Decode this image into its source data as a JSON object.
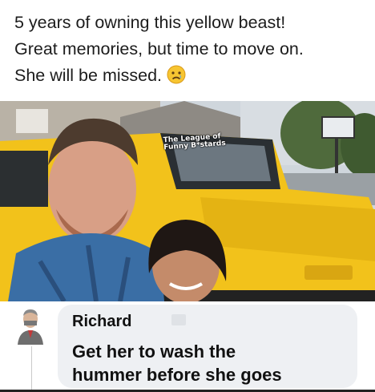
{
  "post": {
    "line1": "5 years of owning this yellow beast!",
    "line2": "Great memories, but time to move on.",
    "line3": "She will be missed.",
    "emoji": "sad-face-emoji"
  },
  "photo": {
    "watermark_line1": "The League of",
    "watermark_line2": "Funny B*stards",
    "vehicle_color": "#f2c21b"
  },
  "comment": {
    "author": "Richard",
    "text_line1": "Get her to wash the",
    "text_line2": "hummer before she goes",
    "bubble_color": "#eef0f3"
  }
}
